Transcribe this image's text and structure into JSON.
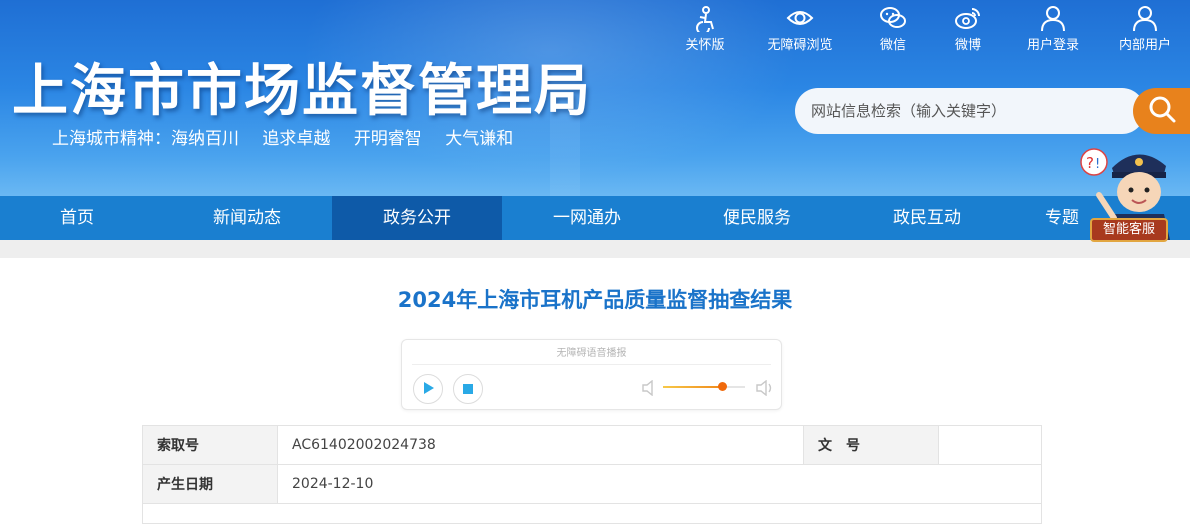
{
  "header": {
    "title": "上海市市场监督管理局",
    "slogan": [
      "上海城市精神：海纳百川",
      "追求卓越",
      "开明睿智",
      "大气谦和"
    ],
    "tools": [
      {
        "label": "关怀版",
        "icon": "care-icon"
      },
      {
        "label": "无障碍浏览",
        "icon": "eye-icon"
      },
      {
        "label": "微信",
        "icon": "wechat-icon"
      },
      {
        "label": "微博",
        "icon": "weibo-icon"
      },
      {
        "label": "用户登录",
        "icon": "user-icon"
      },
      {
        "label": "内部用户",
        "icon": "user-icon"
      }
    ],
    "search": {
      "placeholder": "网站信息检索（输入关键字）"
    }
  },
  "nav": {
    "items": [
      "首页",
      "新闻动态",
      "政务公开",
      "一网通办",
      "便民服务",
      "政民互动",
      "专题"
    ],
    "active": "政务公开"
  },
  "service": {
    "label": "智能客服"
  },
  "article": {
    "title": "2024年上海市耳机产品质量监督抽查结果",
    "player": {
      "caption": "无障碍语音播报",
      "volume": 0.72
    },
    "info": {
      "index_label": "索取号",
      "index_value": "AC61402002024738",
      "docno_label": "文　号",
      "docno_value": "",
      "date_label": "产生日期",
      "date_value": "2024-12-10"
    }
  },
  "colors": {
    "banner": "#2b86e4",
    "nav": "#1a7fd0",
    "nav_active": "#0e5aa8",
    "title": "#1a73c9",
    "search_btn": "#e8821c"
  }
}
